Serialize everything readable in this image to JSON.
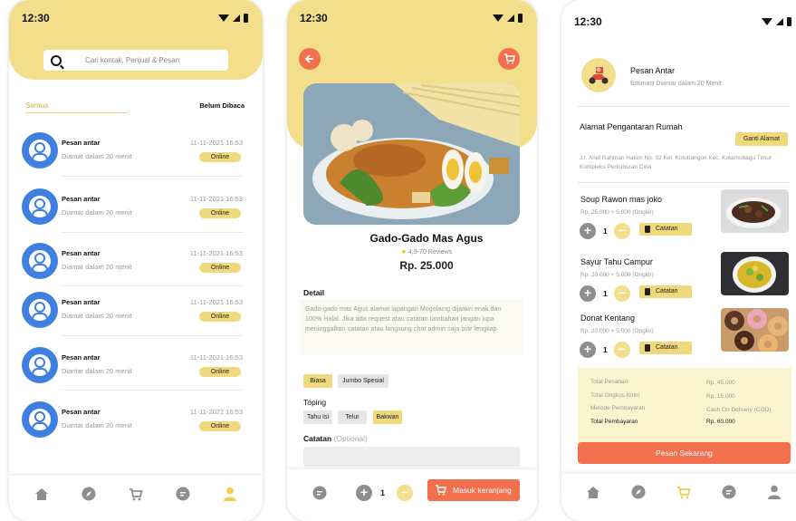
{
  "screen1": {
    "status_time": "12:30",
    "search_placeholder": "Cari kontak, Penjual & Pesan",
    "tab_all": "Semua",
    "tab_unread": "Belum Dibaca",
    "chats": [
      {
        "name": "Pesan antar",
        "subtitle": "Diantar dalam 20 menit",
        "date": "11-11-2021",
        "time": "16:53",
        "badge": "Online"
      },
      {
        "name": "Pesan antar",
        "subtitle": "Diantar dalam 20 menit",
        "date": "11-11-2021",
        "time": "16:53",
        "badge": "Online"
      },
      {
        "name": "Pesan antar",
        "subtitle": "Diantar dalam 20 menit",
        "date": "11-11-2021",
        "time": "16:53",
        "badge": "Online"
      },
      {
        "name": "Pesan antar",
        "subtitle": "Diantar dalam 20 menit",
        "date": "11-11-2021",
        "time": "16:53",
        "badge": "Online"
      },
      {
        "name": "Pesan antar",
        "subtitle": "Diantar dalam 20 menit",
        "date": "11-11-2021",
        "time": "16:53",
        "badge": "Online"
      },
      {
        "name": "Pesan antar",
        "subtitle": "Diantar dalam 20 menit",
        "date": "11-11-2021",
        "time": "16:53",
        "badge": "Online"
      }
    ],
    "nav_icons": [
      "home-icon",
      "explore-icon",
      "cart-icon",
      "chat-icon",
      "profile-icon"
    ]
  },
  "screen2": {
    "status_time": "12:30",
    "product_name": "Gado-Gado Mas Agus",
    "rating": "4,9-70 Reviews",
    "price": "Rp. 25.000",
    "detail_label": "Detail",
    "detail_text": "Gado-gado mas Agus alamat lapangan  Mogolaing dijamin enak dan 100% Halal. Jika ada request atau catatan tambahan jangan lupa meninggalkan catatan atau langsung chat admin saja biar lengkap",
    "size_options": [
      "Biasa",
      "Jumbo Spesial"
    ],
    "toping_label": "Toping",
    "toping_options": [
      "Tahu Isi",
      "Telur",
      "Bakwan"
    ],
    "catatan_label": "Catatan",
    "catatan_optional": "(Optional)",
    "quantity": "1",
    "add_to_cart": "Masuk keranjang"
  },
  "screen3": {
    "status_time": "12:30",
    "delivery_title": "Pesan Antar",
    "delivery_sub": "Estimasi Diantar dalam 20 Menit",
    "address_title": "Alamat Pengantaran Rumah",
    "change_address": "Ganti Alamat",
    "address_text": "J.l. Arief Rahman Hakim No. 32 Kel. Kotobangon Kec. Kotamobagu Timur Kompleks Perkuburan Cina",
    "items": [
      {
        "name": "Soup Rawon mas joko",
        "price": "Rp. 25.000 +  5.000 (Ongkir)",
        "qty": "1",
        "note": "Catatan"
      },
      {
        "name": "Sayur Tahu Campur",
        "price": "Rp. 20.000 +  5.000 (Ongkir)",
        "qty": "1",
        "note": "Catatan"
      },
      {
        "name": "Donat Kentang",
        "price": "Rp. 20.000 +  5.000 (Ongkir)",
        "qty": "1",
        "note": "Catatan"
      }
    ],
    "summary": {
      "total_label": "Total Pesanan",
      "total_value": "Rp. 45.000",
      "ongkir_label": "Total Ongkos Kirim",
      "ongkir_value": "Rp. 15.000",
      "method_label": "Metode Pembayaran",
      "method_value": "Cash On Delivery (COD)",
      "pay_label": "Total Pembayaran",
      "pay_value": "Rp. 60.000"
    },
    "order_button": "Pesan Sekarang"
  },
  "colors": {
    "accent_yellow": "#f3df8b",
    "accent_orange": "#f2704e",
    "avatar_blue": "#3e7fe0"
  }
}
